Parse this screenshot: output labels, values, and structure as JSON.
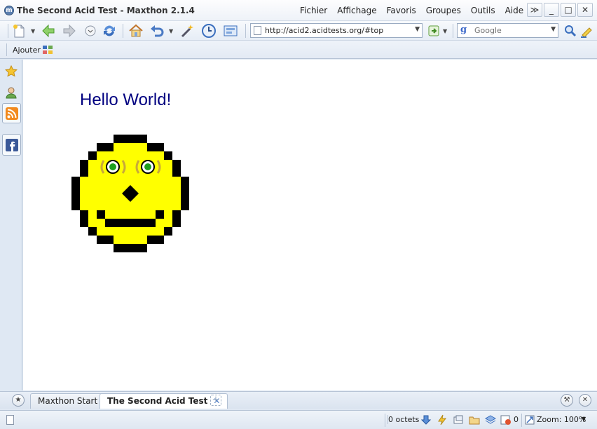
{
  "window": {
    "title": "The Second Acid Test - Maxthon 2.1.4",
    "app_icon_letter": "m",
    "controls": [
      "≫",
      "_",
      "□",
      "✕"
    ]
  },
  "menu": [
    "Fichier",
    "Affichage",
    "Favoris",
    "Groupes",
    "Outils",
    "Aide"
  ],
  "toolbar": {
    "address": "http://acid2.acidtests.org/#top",
    "search_engine_letter": "g",
    "search_placeholder": "Google"
  },
  "favorites_bar": {
    "add_label": "Ajouter"
  },
  "page": {
    "heading": "Hello World!"
  },
  "tabs": [
    {
      "label": "Maxthon Start",
      "active": false
    },
    {
      "label": "The Second Acid Test",
      "active": true,
      "close": "✕"
    }
  ],
  "tab_bar": {
    "new_tab": "+",
    "left_button": "★",
    "right_tools": "⚒",
    "right_close": "✕"
  },
  "statusbar": {
    "size": "0 octets",
    "counter": "0",
    "zoom": "Zoom: 100%",
    "zoom_dropdown": "▼"
  },
  "colors": {
    "face_yellow": "#ffff00",
    "heading_navy": "#000080",
    "eye_green": "#1ea01e"
  }
}
